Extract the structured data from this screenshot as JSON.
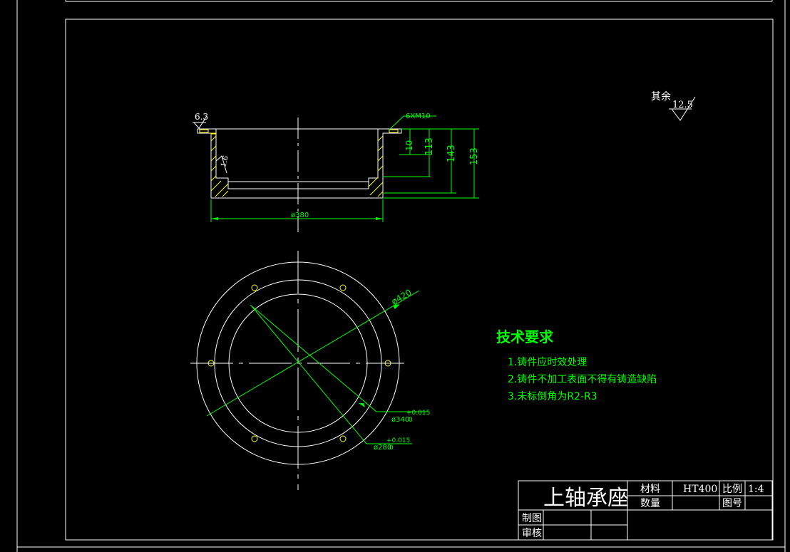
{
  "colors": {
    "background": "#000000",
    "outline": "#ffffff",
    "dimension": "#00ff00",
    "hatch": "#ffff00"
  },
  "surface_finish": {
    "other_label": "其余",
    "other_value": "12.5",
    "top_left": "6.3",
    "inner": "1.6"
  },
  "dimensions": {
    "thread_note": "6XM10",
    "h1": "10",
    "h2": "113",
    "h3": "143",
    "h4": "153",
    "outer_width": "ø380",
    "dia_outer": "ø420",
    "dia_mid": "ø340",
    "dia_mid_tol": "+0.015",
    "dia_mid_tol_low": "0",
    "dia_inner": "ø280",
    "dia_inner_tol": "+0.015",
    "dia_inner_tol_low": "0"
  },
  "requirements": {
    "title": "技术要求",
    "items": [
      "1.铸件应时效处理",
      "2.铸件不加工表面不得有铸造缺陷",
      "3.未标倒角为R2-R3"
    ]
  },
  "title_block": {
    "part_name": "上轴承座",
    "material_label": "材料",
    "material_value": "HT400",
    "scale_label": "比例",
    "scale_value": "1:4",
    "quantity_label": "数量",
    "drawing_no_label": "图号",
    "drawn_label": "制图",
    "checked_label": "审核"
  }
}
